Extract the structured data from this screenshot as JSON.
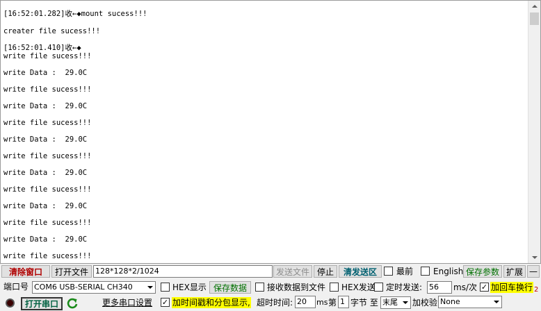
{
  "terminal": {
    "lines": [
      {
        "ts": "[16:52:01.282]",
        "text": "收←◆mount sucess!!!"
      },
      {
        "ts": "",
        "text": "creater file sucess!!!"
      },
      {
        "ts": "[16:52:01.410]",
        "text": "收←◆"
      },
      {
        "ts": "",
        "text": "write file sucess!!!"
      },
      {
        "ts": "",
        "text": "write Data :  29.0C"
      },
      {
        "ts": "",
        "text": "write file sucess!!!"
      },
      {
        "ts": "",
        "text": "write Data :  29.0C"
      },
      {
        "ts": "",
        "text": "write file sucess!!!"
      },
      {
        "ts": "",
        "text": "write Data :  29.0C"
      },
      {
        "ts": "",
        "text": "write file sucess!!!"
      },
      {
        "ts": "",
        "text": "write Data :  29.0C"
      },
      {
        "ts": "",
        "text": "write file sucess!!!"
      },
      {
        "ts": "",
        "text": "write Data :  29.0C"
      },
      {
        "ts": "",
        "text": "write file sucess!!!"
      },
      {
        "ts": "",
        "text": "write Data :  29.0C"
      },
      {
        "ts": "",
        "text": "write file sucess!!!"
      }
    ]
  },
  "row1": {
    "clear_window": "清除窗口",
    "open_file": "打开文件",
    "file_path": "128*128*2/1024",
    "send_file": "发送文件",
    "stop": "停止",
    "clear_send": "清发送区",
    "topmost_checked": false,
    "topmost": "最前",
    "english_checked": false,
    "english": "English",
    "save_params": "保存参数",
    "expand": "扩展",
    "minus": "—"
  },
  "row2": {
    "port_label": "端口号",
    "port_value": "COM6 USB-SERIAL CH340",
    "hex_display_checked": false,
    "hex_display": "HEX显示",
    "save_data": "保存数据",
    "recv_to_file_checked": false,
    "recv_to_file": "接收数据到文件",
    "hex_send_checked": false,
    "hex_send": "HEX发送",
    "timed_send_checked": false,
    "timed_send": "定时发送:",
    "interval": "56",
    "interval_unit": "ms/次",
    "add_crlf_checked": true,
    "add_crlf": "加回车换行",
    "overflow_mark": "2"
  },
  "row3": {
    "open_port": "打开串口",
    "more_settings": "更多串口设置",
    "add_timestamp_checked": true,
    "add_timestamp": "加时间戳和分包显示,",
    "timeout_label": "超时时间:",
    "timeout_value": "20",
    "timeout_unit": "ms",
    "byte_prefix": "第",
    "byte_value": "1",
    "byte_suffix": "字节 至",
    "end_value": "末尾",
    "checksum_label": "加校验",
    "checksum_value": "None"
  },
  "check_mark": "✓",
  "colors": {
    "clear_window": "#b00000",
    "clear_send": "#006070",
    "save_green": "#007000",
    "highlight": "#ffff00"
  }
}
